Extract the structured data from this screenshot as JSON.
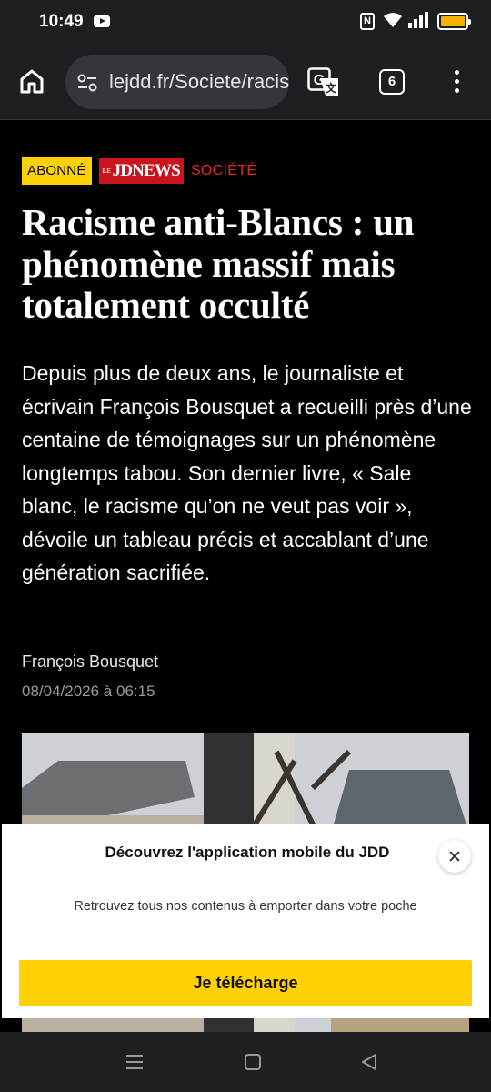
{
  "status_bar": {
    "time": "10:49",
    "icons": [
      "youtube-icon",
      "nfc-icon",
      "wifi-icon",
      "signal-icon",
      "battery-icon"
    ],
    "nfc_letter": "N"
  },
  "browser": {
    "url": "lejdd.fr/Societe/racisme",
    "tab_count": "6",
    "icons": [
      "home-icon",
      "site-settings-icon",
      "translate-icon",
      "tabs-icon",
      "menu-icon"
    ]
  },
  "article": {
    "badge_subscriber": "ABONNÉ",
    "badge_brand": "JDNEWS",
    "badge_brand_prefix": "LE",
    "section": "SOCIÉTÉ",
    "title": "Racisme anti-Blancs : un phénomène massif mais totalement occulté",
    "lead": "Depuis plus de deux ans, le journaliste et écrivain François Bousquet a recueilli près d’une centaine de témoignages sur un phénomène longtemps tabou. Son dernier livre, « Sale blanc, le racisme qu’on ne veut pas voir », dévoile un tableau précis et accablant d’une génération sacrifiée.",
    "author": "François Bousquet",
    "date": "08/04/2026 à 06:15"
  },
  "popup": {
    "title": "Découvrez l'application mobile du JDD",
    "subtitle": "Retrouvez tous nos contenus à emporter dans votre poche",
    "button": "Je télécharge"
  },
  "colors": {
    "accent_yellow": "#fed105",
    "brand_red": "#c9141d",
    "section_red": "#e2282e",
    "battery": "#f6b100"
  }
}
